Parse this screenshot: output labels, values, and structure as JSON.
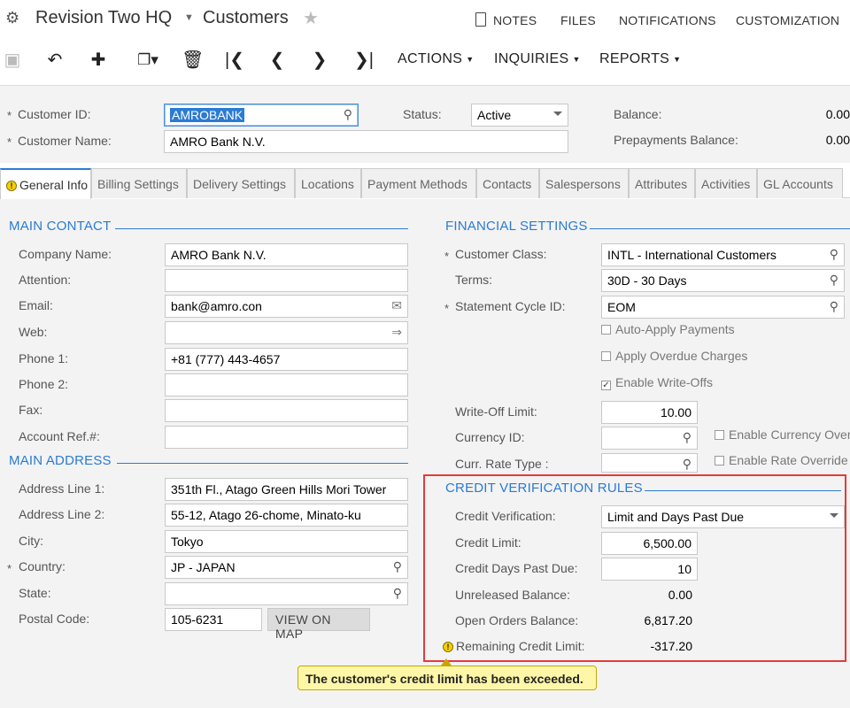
{
  "header": {
    "company": "Revision Two HQ",
    "screen": "Customers",
    "links": {
      "notes": "NOTES",
      "files": "FILES",
      "notifications": "NOTIFICATIONS",
      "customization": "CUSTOMIZATION"
    }
  },
  "toolbar": {
    "actions": "ACTIONS",
    "inquiries": "INQUIRIES",
    "reports": "REPORTS"
  },
  "summary": {
    "customer_id_label": "Customer ID:",
    "customer_id_value": "AMROBANK",
    "customer_name_label": "Customer Name:",
    "customer_name_value": "AMRO Bank N.V.",
    "status_label": "Status:",
    "status_value": "Active",
    "balance_label": "Balance:",
    "balance_value": "0.00",
    "prepayments_label": "Prepayments Balance:",
    "prepayments_value": "0.00"
  },
  "tabs": [
    "General Info",
    "Billing Settings",
    "Delivery Settings",
    "Locations",
    "Payment Methods",
    "Contacts",
    "Salespersons",
    "Attributes",
    "Activities",
    "GL Accounts"
  ],
  "main_contact": {
    "heading": "MAIN CONTACT",
    "company_name_label": "Company Name:",
    "company_name_value": "AMRO Bank N.V.",
    "attention_label": "Attention:",
    "email_label": "Email:",
    "email_value": "bank@amro.con",
    "web_label": "Web:",
    "phone1_label": "Phone 1:",
    "phone1_value": "+81 (777) 443-4657",
    "phone2_label": "Phone 2:",
    "fax_label": "Fax:",
    "account_ref_label": "Account Ref.#:"
  },
  "main_address": {
    "heading": "MAIN ADDRESS",
    "line1_label": "Address Line 1:",
    "line1_value": "351th Fl., Atago Green Hills Mori Tower",
    "line2_label": "Address Line 2:",
    "line2_value": "55-12, Atago 26-chome, Minato-ku",
    "city_label": "City:",
    "city_value": "Tokyo",
    "country_label": "Country:",
    "country_value": "JP - JAPAN",
    "state_label": "State:",
    "postal_label": "Postal Code:",
    "postal_value": "105-6231",
    "map_button": "VIEW ON MAP"
  },
  "financial": {
    "heading": "FINANCIAL SETTINGS",
    "class_label": "Customer Class:",
    "class_value": "INTL - International Customers",
    "terms_label": "Terms:",
    "terms_value": "30D - 30 Days",
    "cycle_label": "Statement Cycle ID:",
    "cycle_value": "EOM",
    "auto_apply": "Auto-Apply Payments",
    "overdue": "Apply Overdue Charges",
    "write_offs": "Enable Write-Offs",
    "writeoff_limit_label": "Write-Off Limit:",
    "writeoff_limit_value": "10.00",
    "currency_label": "Currency ID:",
    "rate_type_label": "Curr. Rate Type :",
    "enable_currency": "Enable Currency Override",
    "enable_rate": "Enable Rate Override"
  },
  "credit": {
    "heading": "CREDIT VERIFICATION RULES",
    "verification_label": "Credit Verification:",
    "verification_value": "Limit and Days Past Due",
    "limit_label": "Credit Limit:",
    "limit_value": "6,500.00",
    "days_label": "Credit Days Past Due:",
    "days_value": "10",
    "unreleased_label": "Unreleased Balance:",
    "unreleased_value": "0.00",
    "open_orders_label": "Open Orders Balance:",
    "open_orders_value": "6,817.20",
    "remaining_label": "Remaining Credit Limit:",
    "remaining_value": "-317.20",
    "warning": "The customer's credit limit has been exceeded."
  },
  "colors": {
    "accent": "#2b7bd3",
    "highlight": "#e43a3a",
    "warning": "#fff7a8"
  }
}
